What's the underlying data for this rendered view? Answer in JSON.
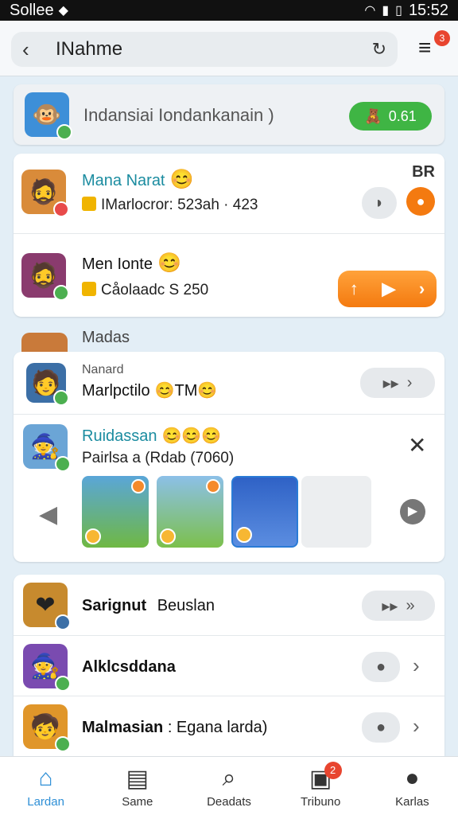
{
  "status_bar": {
    "carrier": "Sollee",
    "time": "15:52"
  },
  "header": {
    "title": "INahme",
    "menu_badge": "3"
  },
  "banner": {
    "text": "Indansiai Iondankanain )",
    "button_label": "0.61"
  },
  "list_top": [
    {
      "name": "Mana Narat",
      "emoji": "😊",
      "detail": "IMarlocror: 523ah · 423",
      "corner": "BR"
    },
    {
      "name": "Men Ionte",
      "emoji": "😊",
      "detail": "Cåolaadc S 250"
    }
  ],
  "section_label": "Madas",
  "featured": [
    {
      "tag": "Nanard",
      "name": "Marlpctilo",
      "emoji": "😊TM😊"
    },
    {
      "name": "Ruidassan",
      "emoji": "😊😊😊",
      "detail": "Pairlsa a (Rdab (7060)"
    }
  ],
  "list_bottom": [
    {
      "name": "Sarignut",
      "detail": "Beuslan"
    },
    {
      "name": "Alklcsddana",
      "detail": ""
    },
    {
      "name": "Malmasian",
      "detail": " : Egana larda)"
    }
  ],
  "nav": [
    {
      "label": "Lardan",
      "icon": "home-icon"
    },
    {
      "label": "Same",
      "icon": "document-icon"
    },
    {
      "label": "Deadats",
      "icon": "search-icon"
    },
    {
      "label": "Tribuno",
      "icon": "message-icon",
      "badge": "2"
    },
    {
      "label": "Karlas",
      "icon": "profile-icon"
    }
  ],
  "colors": {
    "accent": "#2e8fd6",
    "green": "#3fb544",
    "orange": "#f47a10",
    "badge": "#e8452f"
  }
}
